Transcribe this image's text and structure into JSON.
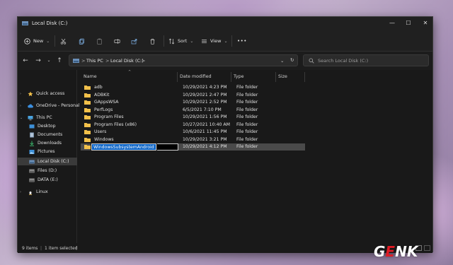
{
  "window": {
    "title": "Local Disk (C:)",
    "controls": {
      "minimize": "—",
      "maximize": "☐",
      "close": "✕"
    }
  },
  "toolbar": {
    "new_label": "New",
    "sort_label": "Sort",
    "view_label": "View",
    "more_label": "•••",
    "chevron": "⌄"
  },
  "address": {
    "crumbs": [
      "This PC",
      "Local Disk (C:)"
    ],
    "separator": ">",
    "search_placeholder": "Search Local Disk (C:)"
  },
  "sidebar": {
    "items": [
      {
        "label": "Quick access",
        "icon": "star-icon"
      },
      {
        "label": "OneDrive - Personal",
        "icon": "cloud-icon"
      },
      {
        "label": "This PC",
        "icon": "computer-icon"
      },
      {
        "label": "Desktop",
        "icon": "desktop-icon"
      },
      {
        "label": "Documents",
        "icon": "documents-icon"
      },
      {
        "label": "Downloads",
        "icon": "downloads-icon"
      },
      {
        "label": "Pictures",
        "icon": "pictures-icon"
      },
      {
        "label": "Local Disk (C:)",
        "icon": "drive-icon"
      },
      {
        "label": "Files (D:)",
        "icon": "drive-icon"
      },
      {
        "label": "DATA (E:)",
        "icon": "drive-icon"
      },
      {
        "label": "Linux",
        "icon": "linux-icon"
      }
    ]
  },
  "columns": {
    "name": "Name",
    "date": "Date modified",
    "type": "Type",
    "size": "Size"
  },
  "files": [
    {
      "name": "adb",
      "date": "10/29/2021 4:23 PM",
      "type": "File folder"
    },
    {
      "name": "ADBKit",
      "date": "10/29/2021 2:47 PM",
      "type": "File folder"
    },
    {
      "name": "GAppsWSA",
      "date": "10/29/2021 2:52 PM",
      "type": "File folder"
    },
    {
      "name": "PerfLogs",
      "date": "6/5/2021 7:10 PM",
      "type": "File folder"
    },
    {
      "name": "Program Files",
      "date": "10/29/2021 1:56 PM",
      "type": "File folder"
    },
    {
      "name": "Program Files (x86)",
      "date": "10/27/2021 10:40 AM",
      "type": "File folder"
    },
    {
      "name": "Users",
      "date": "10/6/2021 11:45 PM",
      "type": "File folder"
    },
    {
      "name": "Windows",
      "date": "10/29/2021 3:21 PM",
      "type": "File folder"
    },
    {
      "name": "WindowsSubsystemAndroid",
      "date": "10/29/2021 4:12 PM",
      "type": "File folder"
    }
  ],
  "status": {
    "count": "9 items",
    "selected": "1 item selected",
    "divider": "|"
  },
  "watermark": {
    "g": "G",
    "e": "E",
    "nk": "NK"
  },
  "colors": {
    "accent": "#0a64c8",
    "folder": "#f2c04a",
    "brand_red": "#e01b24"
  }
}
